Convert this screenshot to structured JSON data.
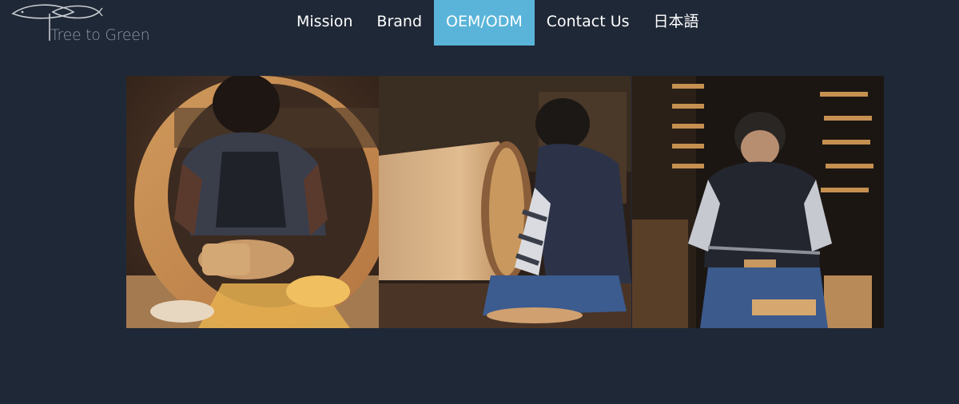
{
  "logo": {
    "text": "Tree to Green",
    "icon": "fish-tree-logo-icon"
  },
  "nav": {
    "items": [
      {
        "label": "Mission",
        "active": false
      },
      {
        "label": "Brand",
        "active": false
      },
      {
        "label": "OEM/ODM",
        "active": true
      },
      {
        "label": "Contact Us",
        "active": false
      },
      {
        "label": "日本語",
        "active": false
      }
    ],
    "active_color": "#5ab4d9"
  },
  "colors": {
    "background": "#1f2836",
    "wood": "#c8884a",
    "workshop_dark": "#2a1e16"
  },
  "gallery": {
    "photos": [
      {
        "depicts": "craftsman planing inside a large wooden barrel ring"
      },
      {
        "depicts": "craftsman in vest assembling a large wooden tub"
      },
      {
        "depicts": "craftsman shaving wood with a drawknife in workshop"
      }
    ]
  }
}
